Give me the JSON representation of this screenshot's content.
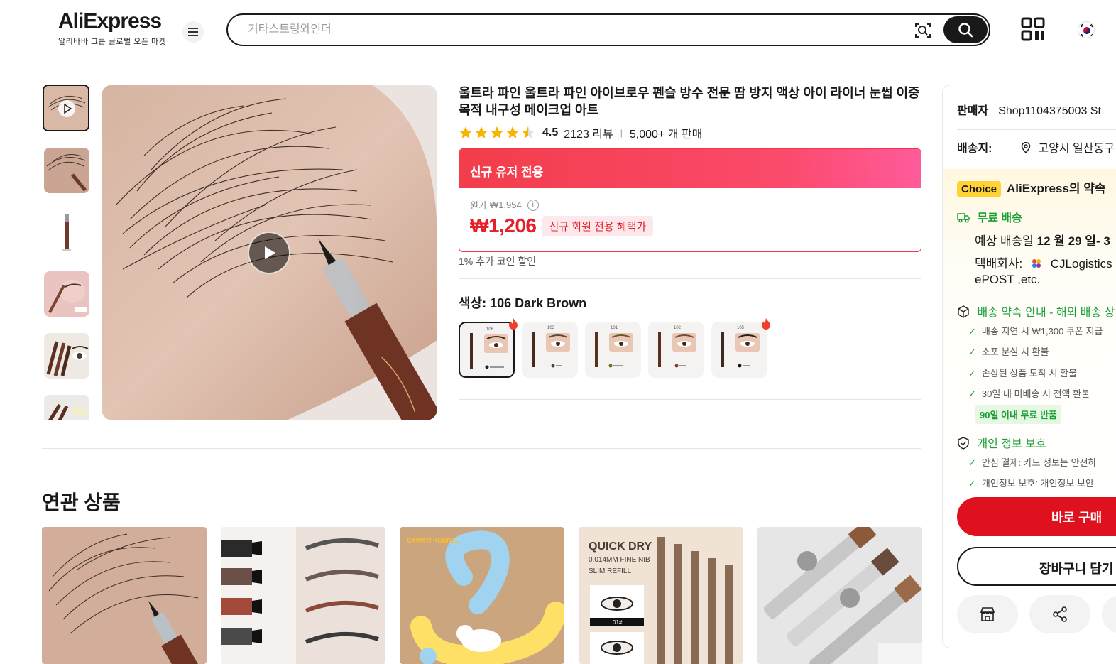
{
  "header": {
    "logo_text": "AliExpress",
    "logo_tagline": "알리바바 그룹 글로벌 오픈 마켓",
    "search_placeholder": "기타스트링와인더"
  },
  "product": {
    "title": "울트라 파인 울트라 파인 아이브로우 펜슬 방수 전문 땀 방지 액상 아이 라이너 눈썹 이중 목적 내구성 메이크업 아트",
    "rating": "4.5",
    "reviews": "2123 리뷰",
    "sold": "5,000+ 개 판매",
    "promo_header": "신규 유저 전용",
    "original_price_label": "원가",
    "original_price": "₩1,954",
    "price": "₩1,206",
    "price_badge": "신규 회원 전용 혜택가",
    "coin_discount": "1% 추가 코인 할인",
    "color_label": "색상: 106 Dark Brown",
    "swatch_labels": [
      "106",
      "103",
      "101",
      "102",
      "105"
    ]
  },
  "related": {
    "title": "연관 상품",
    "card3_brand": "CAWAYI KENNEL",
    "card4_heading": "QUICK DRY",
    "card4_sub1": "0.014MM FINE NIB",
    "card4_sub2": "SLIM REFILL",
    "card4_tag": "01#"
  },
  "side": {
    "seller_label": "판매자",
    "seller_name": "Shop1104375003 St",
    "ship_to_label": "배송지:",
    "ship_to": "고양시 일산동구",
    "choice_badge": "Choice",
    "choice_text": "AliExpress의 약속",
    "free_shipping": "무료 배송",
    "delivery_prefix": "예상 배송일",
    "delivery_date": "12 월 29 일- 3",
    "courier_label": "택배회사:",
    "courier": "CJLogistics",
    "courier_more": "ePOST ,etc.",
    "promise_title": "배송 약속 안내 - 해외 배송 상",
    "promise_items": [
      "배송 지연 시 ₩1,300 쿠폰 지급",
      "소포 분실 시 환불",
      "손상된 상품 도착 시 환불",
      "30일 내 미배송 시 전액 환불"
    ],
    "return_badge": "90일 이내 무료 반품",
    "privacy_title": "개인 정보 보호",
    "privacy_items": [
      "안심 결제: 카드 정보는 안전하",
      "개인정보 보호: 개인정보 보안"
    ],
    "buy_now": "바로 구매",
    "add_cart": "장바구니 담기"
  },
  "colors": {
    "accent_red": "#e0111f",
    "price_red": "#e4202b",
    "green": "#1aa037",
    "choice_yellow": "#ffd335"
  },
  "icons": [
    "menu-icon",
    "camera-search-icon",
    "search-icon",
    "qr-code-icon",
    "korea-flag-icon",
    "play-icon",
    "star-icon",
    "info-icon",
    "fire-icon",
    "location-icon",
    "truck-icon",
    "box-icon",
    "shield-icon",
    "store-icon",
    "share-icon"
  ]
}
